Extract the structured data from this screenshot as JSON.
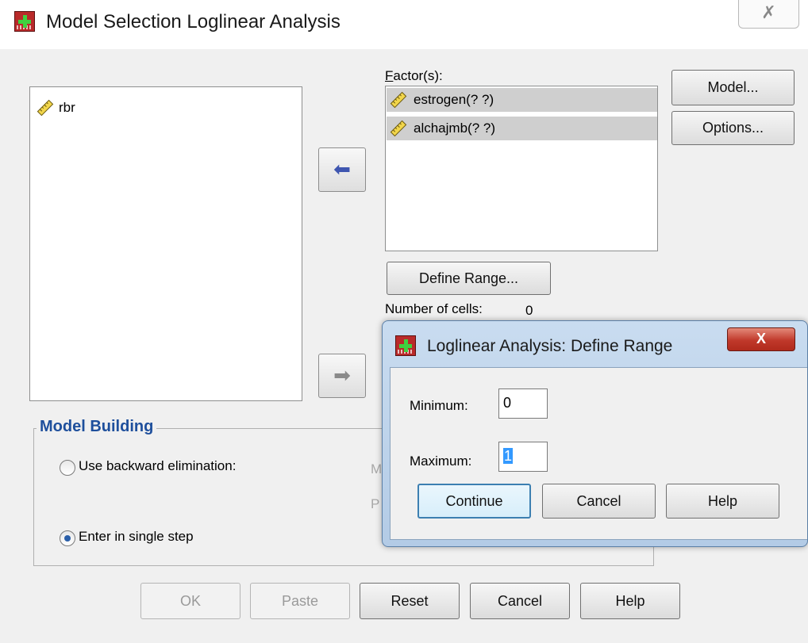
{
  "main_dialog": {
    "title": "Model Selection Loglinear Analysis",
    "close_glyph": "✗",
    "source_list": [
      "rbr"
    ],
    "factors_label": "Factor(s):",
    "factors": [
      "estrogen(? ?)",
      "alchajmb(? ?)"
    ],
    "buttons": {
      "model": "Model...",
      "options": "Options...",
      "define_range": "Define Range...",
      "ok": "OK",
      "paste": "Paste",
      "reset": "Reset",
      "cancel": "Cancel",
      "help": "Help"
    },
    "move_factor_arrow": "⬅",
    "move_cell_arrow": "➡",
    "number_of_cells_label": "Number of cells:",
    "number_of_cells_value": "0",
    "model_building": {
      "title": "Model Building",
      "option_backward": "Use backward elimination:",
      "option_single": "Enter in single step",
      "selected": "Enter in single step"
    }
  },
  "define_range_dialog": {
    "title": "Loglinear Analysis: Define Range",
    "close_glyph": "X",
    "minimum_label": "Minimum:",
    "minimum_value": "0",
    "maximum_label": "Maximum:",
    "maximum_value": "1",
    "buttons": {
      "continue": "Continue",
      "cancel": "Cancel",
      "help": "Help"
    }
  },
  "icons": {
    "app": "spss-table-icon",
    "variable": "ruler-scale-icon"
  },
  "colors": {
    "group_title": "#1e4f9c",
    "selection_bg": "#cfcfcf",
    "sub_close": "#c0392b",
    "focus_border": "#3c7fb1"
  }
}
